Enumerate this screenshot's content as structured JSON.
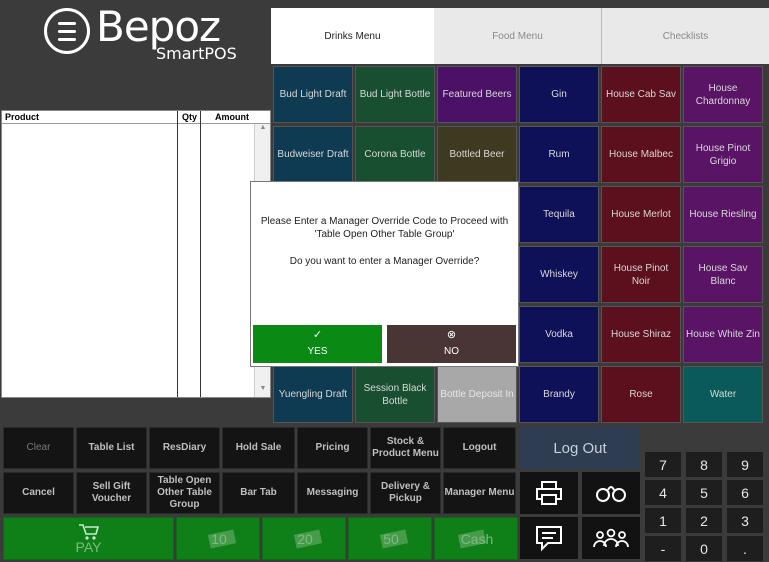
{
  "logo": {
    "brand": "Bepoz",
    "product": "SmartPOS"
  },
  "product_table": {
    "columns": [
      "Product",
      "Qty",
      "Amount"
    ]
  },
  "tabs": [
    {
      "label": "Drinks Menu",
      "active": true
    },
    {
      "label": "Food Menu",
      "active": false
    },
    {
      "label": "Checklists",
      "active": false
    }
  ],
  "menu_items": [
    {
      "label": "Bud Light Draft",
      "color": "#0e3a52"
    },
    {
      "label": "Bud Light Bottle",
      "color": "#174f30"
    },
    {
      "label": "Featured Beers",
      "color": "#4a1166"
    },
    {
      "label": "Gin",
      "color": "#0f1158"
    },
    {
      "label": "House Cab Sav",
      "color": "#5c0f1c"
    },
    {
      "label": "House Chardonnay",
      "color": "#5a1466"
    },
    {
      "label": "Budweiser Draft",
      "color": "#0e3a52"
    },
    {
      "label": "Corona Bottle",
      "color": "#174f30"
    },
    {
      "label": "Bottled Beer",
      "color": "#3d3a1f"
    },
    {
      "label": "Rum",
      "color": "#0f1158"
    },
    {
      "label": "House Malbec",
      "color": "#5c0f1c"
    },
    {
      "label": "House Pinot Grigio",
      "color": "#5a1466"
    },
    {
      "label": "Tequila",
      "color": "#0f1158"
    },
    {
      "label": "House Merlot",
      "color": "#5c0f1c"
    },
    {
      "label": "House Riesling",
      "color": "#5a1466"
    },
    {
      "label": "Whiskey",
      "color": "#0f1158"
    },
    {
      "label": "House Pinot Noir",
      "color": "#5c0f1c"
    },
    {
      "label": "House Sav Blanc",
      "color": "#5a1466"
    },
    {
      "label": "Vodka",
      "color": "#0f1158"
    },
    {
      "label": "House Shiraz",
      "color": "#5c0f1c"
    },
    {
      "label": "House White Zin",
      "color": "#5a1466"
    },
    {
      "label": "Yuengling Draft",
      "color": "#0e3a52"
    },
    {
      "label": "Session Black Bottle",
      "color": "#174f30"
    },
    {
      "label": "Bottle Deposit In",
      "color": "#a8a8a8"
    },
    {
      "label": "Brandy",
      "color": "#0f1158"
    },
    {
      "label": "Rose",
      "color": "#5c0f1c"
    },
    {
      "label": "Water",
      "color": "#0b5a5a"
    }
  ],
  "dialog": {
    "line1": "Please Enter a Manager Override Code to Proceed with",
    "line2": "'Table Open Other Table Group'",
    "line3": "Do you want to enter a Manager Override?",
    "yes_icon": "✓",
    "yes_label": "YES",
    "no_icon": "⊗",
    "no_label": "NO"
  },
  "functions": [
    "Clear",
    "Table List",
    "ResDiary",
    "Hold Sale",
    "Pricing",
    "Stock & Product Menu",
    "Logout",
    "Cancel",
    "Sell Gift Voucher",
    "Table Open Other Table Group",
    "Bar Tab",
    "Messaging",
    "Delivery & Pickup",
    "Manager Menu"
  ],
  "pay_row": [
    "PAY",
    "10",
    "20",
    "50",
    "Cash"
  ],
  "logout_button": "Log Out",
  "keypad": [
    "7",
    "8",
    "9",
    "4",
    "5",
    "6",
    "1",
    "2",
    "3",
    "-",
    "0",
    "."
  ],
  "icons": [
    "printer-icon",
    "handcuffs-icon",
    "message-icon",
    "group-icon",
    "cart-icon"
  ]
}
